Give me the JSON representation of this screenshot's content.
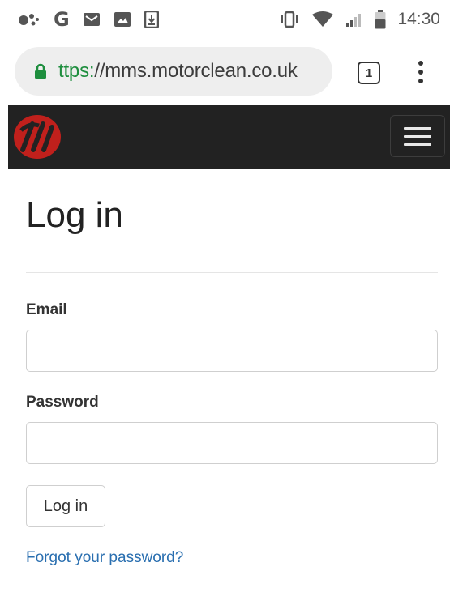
{
  "status_bar": {
    "icons": [
      "assistant-icon",
      "google-g-icon",
      "gmail-icon",
      "image-icon",
      "download-icon",
      "vibrate-icon",
      "wifi-icon",
      "signal-icon",
      "battery-icon"
    ],
    "google_letter": "G",
    "time": "14:30"
  },
  "browser": {
    "url_scheme": "ttps:",
    "url_rest": "//mms.motorclean.co.uk",
    "tab_count": "1",
    "icons": [
      "lock-icon",
      "tabs-icon",
      "more-vert-icon"
    ]
  },
  "navbar": {
    "background": "#222222",
    "logo_color": "#c0201c",
    "icons": [
      "brand-logo-icon",
      "hamburger-menu-icon"
    ]
  },
  "page": {
    "title": "Log in",
    "email_label": "Email",
    "email_value": "",
    "password_label": "Password",
    "password_value": "",
    "submit_label": "Log in",
    "forgot_link": "Forgot your password?",
    "link_color": "#2a6fb0"
  }
}
